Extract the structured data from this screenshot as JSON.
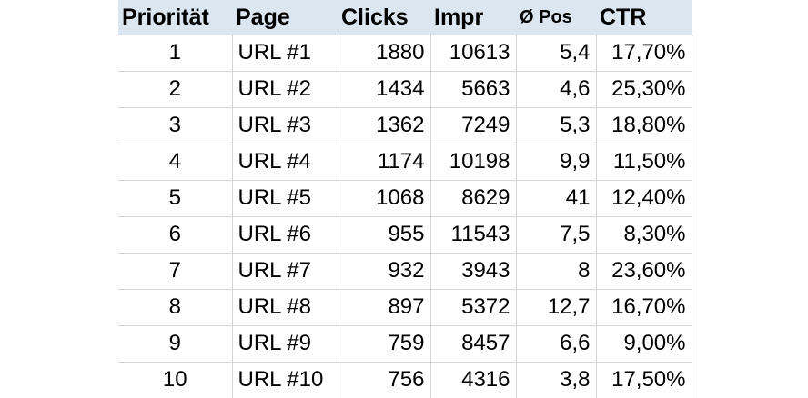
{
  "table": {
    "headers": [
      "Priorität",
      "Page",
      "Clicks",
      "Impr",
      "Ø Pos",
      "CTR"
    ],
    "header_bg": "#dce6f1",
    "grid_color": "#d4d4d4",
    "rows": [
      [
        "1",
        "URL #1",
        "1880",
        "10613",
        "5,4",
        "17,70%"
      ],
      [
        "2",
        "URL #2",
        "1434",
        "5663",
        "4,6",
        "25,30%"
      ],
      [
        "3",
        "URL #3",
        "1362",
        "7249",
        "5,3",
        "18,80%"
      ],
      [
        "4",
        "URL #4",
        "1174",
        "10198",
        "9,9",
        "11,50%"
      ],
      [
        "5",
        "URL #5",
        "1068",
        "8629",
        "41",
        "12,40%"
      ],
      [
        "6",
        "URL #6",
        "955",
        "11543",
        "7,5",
        "8,30%"
      ],
      [
        "7",
        "URL #7",
        "932",
        "3943",
        "8",
        "23,60%"
      ],
      [
        "8",
        "URL #8",
        "897",
        "5372",
        "12,7",
        "16,70%"
      ],
      [
        "9",
        "URL #9",
        "759",
        "8457",
        "6,6",
        "9,00%"
      ],
      [
        "10",
        "URL #10",
        "756",
        "4316",
        "3,8",
        "17,50%"
      ]
    ]
  }
}
